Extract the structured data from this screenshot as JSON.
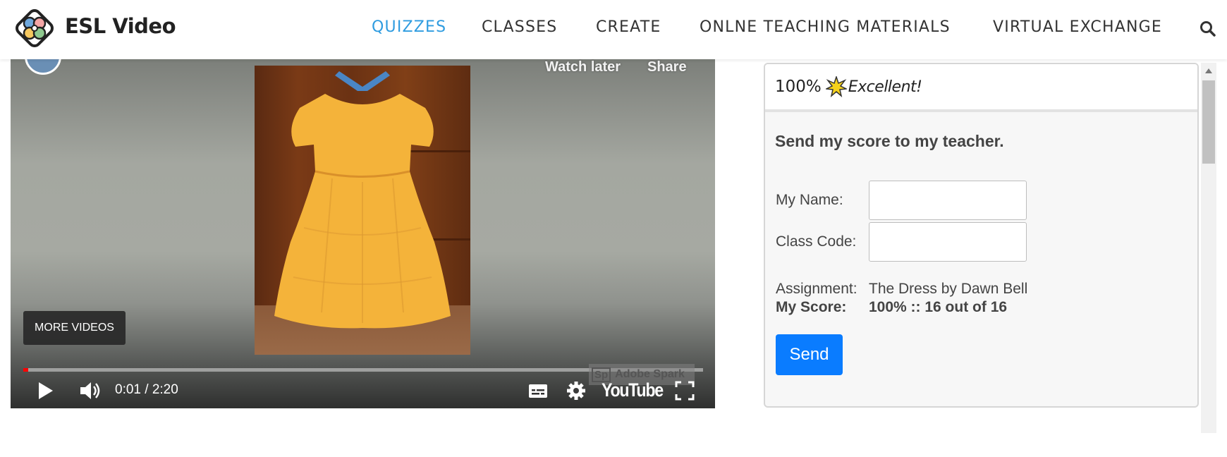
{
  "header": {
    "brand": "ESL Video",
    "nav": [
      {
        "label": "QUIZZES",
        "active": true
      },
      {
        "label": "CLASSES",
        "active": false
      },
      {
        "label": "CREATE",
        "active": false
      },
      {
        "label": "ONLNE TEACHING MATERIALS",
        "active": false
      },
      {
        "label": "VIRTUAL EXCHANGE",
        "active": false
      }
    ],
    "search_icon": "search-icon",
    "accent_color": "#2f9ce0"
  },
  "video": {
    "watch_later": "Watch later",
    "share": "Share",
    "more_videos": "MORE VIDEOS",
    "time": "0:01 / 2:20",
    "progress_fraction": 0.007,
    "watermark": "Adobe Spark",
    "watermark_logo": "Sp",
    "youtube_label": "YouTube",
    "icons": [
      "play-icon",
      "volume-icon",
      "captions-icon",
      "settings-gear-icon",
      "fullscreen-icon"
    ]
  },
  "panel": {
    "score_percent": "100%",
    "rating": "Excellent!",
    "send_title": "Send my score to my teacher.",
    "name_label": "My Name:",
    "name_value": "",
    "class_code_label": "Class Code:",
    "class_code_value": "",
    "assignment_label": "Assignment:",
    "assignment_value": "The Dress by Dawn Bell",
    "score_label": "My Score:",
    "score_value": "100% :: 16 out of 16",
    "send_button": "Send",
    "button_color": "#0a7cff"
  }
}
